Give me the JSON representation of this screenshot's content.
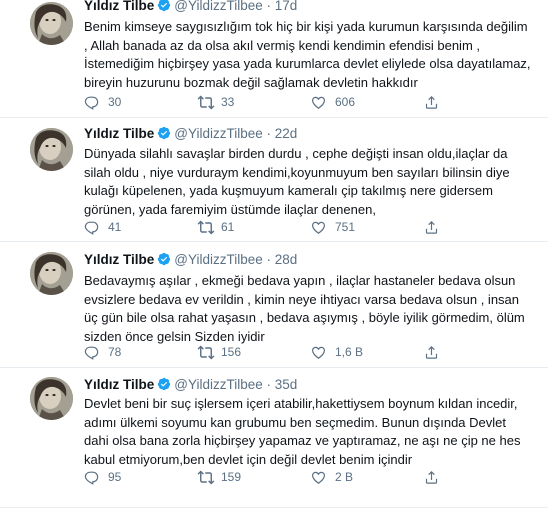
{
  "tweets": [
    {
      "name": "Yıldız Tilbe",
      "handle": "@YildizzTilbee",
      "separator": "·",
      "time": "17d",
      "lines": [
        "Benim kimseye saygısızlığım tok hiç bir kişi yada kurumun karşısında değilim",
        ", Allah banada az da olsa akıl vermiş kendi kendimin efendisi benim ,",
        "İstemediğim hiçbirşey yasa yada kurumlarca devlet eliylede olsa dayatılamaz,",
        "bireyin huzurunu bozmak değil sağlamak devletin hakkıdır"
      ],
      "replies": "30",
      "retweets": "33",
      "likes": "606"
    },
    {
      "name": "Yıldız Tilbe",
      "handle": "@YildizzTilbee",
      "separator": "·",
      "time": "22d",
      "lines": [
        "Dünyada silahlı savaşlar birden durdu , cephe değişti insan oldu,ilaçlar da",
        "silah oldu , niye vurduraym kendimi,koyunmuyum ben sayıları bilinsin diye",
        "kulağı küpelenen, yada kuşmuyum kameralı çip takılmış nere gidersem",
        "görünen, yada faremiyim üstümde ilaçlar denenen,"
      ],
      "replies": "41",
      "retweets": "61",
      "likes": "751"
    },
    {
      "name": "Yıldız Tilbe",
      "handle": "@YildizzTilbee",
      "separator": "·",
      "time": "28d",
      "lines": [
        "Bedavaymış aşılar , ekmeği bedava yapın , ilaçlar hastaneler bedava olsun",
        "evsizlere bedava ev verildin , kimin neye ihtiyacı varsa bedava olsun , insan",
        "üç gün bile olsa rahat yaşasın , bedava aşıymış , böyle iyilik görmedim, ölüm",
        "sizden önce gelsin Sizden iyidir"
      ],
      "replies": "78",
      "retweets": "156",
      "likes": "1,6 B"
    },
    {
      "name": "Yıldız Tilbe",
      "handle": "@YildizzTilbee",
      "separator": "·",
      "time": "35d",
      "lines": [
        "Devlet beni bir suç işlersem içeri atabilir,hakettiysem boynum kıldan incedir,",
        "adımı ülkemi soyumu  kan grubumu ben seçmedim. Bunun dışında Devlet",
        "dahi olsa bana zorla hiçbirşey yapamaz ve yaptıramaz, ne aşı ne çip ne hes",
        "kabul etmiyorum,ben devlet için değil devlet benim içindir"
      ],
      "replies": "95",
      "retweets": "159",
      "likes": "2 B"
    }
  ],
  "icons": {
    "verified": "verified-badge-icon",
    "reply": "reply-icon",
    "retweet": "retweet-icon",
    "like": "heart-icon",
    "share": "share-icon"
  },
  "colors": {
    "verified": "#1da1f2",
    "secondary_text": "#5b7083",
    "divider": "#e6ecf0"
  }
}
